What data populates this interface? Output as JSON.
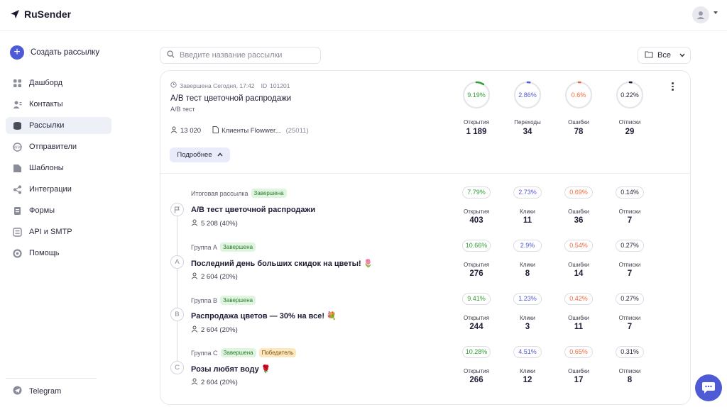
{
  "app": {
    "name": "RuSender"
  },
  "colors": {
    "accent": "#4f5bd5",
    "green": "#2f9e34",
    "blue": "#4f5bd5",
    "orange": "#f0683e",
    "black": "#1d1d35"
  },
  "sidebar": {
    "create_label": "Создать рассылку",
    "items": [
      {
        "label": "Дашборд",
        "icon": "dashboard-icon"
      },
      {
        "label": "Контакты",
        "icon": "contacts-icon"
      },
      {
        "label": "Рассылки",
        "icon": "mailings-icon",
        "active": true
      },
      {
        "label": "Отправители",
        "icon": "senders-icon"
      },
      {
        "label": "Шаблоны",
        "icon": "templates-icon"
      },
      {
        "label": "Интеграции",
        "icon": "integrations-icon"
      },
      {
        "label": "Формы",
        "icon": "forms-icon"
      },
      {
        "label": "API и SMTP",
        "icon": "api-icon"
      },
      {
        "label": "Помощь",
        "icon": "help-icon"
      }
    ],
    "telegram_label": "Telegram"
  },
  "search": {
    "placeholder": "Введите название рассылки"
  },
  "filter": {
    "label": "Все"
  },
  "campaign": {
    "status": "Завершена Сегодня, 17:42",
    "id_label": "ID",
    "id": "101201",
    "title": "А/В тест цветочной распродажи",
    "subtitle": "А/В тест",
    "recipients": "13 020",
    "list_name": "Клиенты Flowwer...",
    "list_count": "(25011)",
    "more_label": "Подробнее",
    "stats": [
      {
        "label": "Открытия",
        "percent": "9.19%",
        "value": "1 189",
        "fraction": 0.0919,
        "color": "#2f9e34"
      },
      {
        "label": "Переходы",
        "percent": "2.86%",
        "value": "34",
        "fraction": 0.0286,
        "color": "#4f5bd5"
      },
      {
        "label": "Ошибки",
        "percent": "0.6%",
        "value": "78",
        "fraction": 0.006,
        "color": "#f0683e"
      },
      {
        "label": "Отписки",
        "percent": "0.22%",
        "value": "29",
        "fraction": 0.0022,
        "color": "#1d1d35"
      }
    ]
  },
  "variants": [
    {
      "marker": "flag",
      "name": "Итоговая рассылка",
      "badges": [
        "Завершена"
      ],
      "title": "А/В тест цветочной распродажи",
      "emoji": "",
      "count": "5 208 (40%)",
      "stats": [
        {
          "label": "Открытия",
          "percent": "7.79%",
          "value": "403"
        },
        {
          "label": "Клики",
          "percent": "2.73%",
          "value": "11"
        },
        {
          "label": "Ошибки",
          "percent": "0.69%",
          "value": "36"
        },
        {
          "label": "Отписки",
          "percent": "0.14%",
          "value": "7"
        }
      ]
    },
    {
      "marker": "A",
      "name": "Группа А",
      "badges": [
        "Завершена"
      ],
      "title": "Последний день больших скидок на цветы!",
      "emoji": "🌷",
      "count": "2 604 (20%)",
      "stats": [
        {
          "label": "Открытия",
          "percent": "10.66%",
          "value": "276"
        },
        {
          "label": "Клики",
          "percent": "2.9%",
          "value": "8"
        },
        {
          "label": "Ошибки",
          "percent": "0.54%",
          "value": "14"
        },
        {
          "label": "Отписки",
          "percent": "0.27%",
          "value": "7"
        }
      ]
    },
    {
      "marker": "B",
      "name": "Группа В",
      "badges": [
        "Завершена"
      ],
      "title": "Распродажа цветов — 30% на все!",
      "emoji": "💐",
      "count": "2 604 (20%)",
      "stats": [
        {
          "label": "Открытия",
          "percent": "9.41%",
          "value": "244"
        },
        {
          "label": "Клики",
          "percent": "1.23%",
          "value": "3"
        },
        {
          "label": "Ошибки",
          "percent": "0.42%",
          "value": "11"
        },
        {
          "label": "Отписки",
          "percent": "0.27%",
          "value": "7"
        }
      ]
    },
    {
      "marker": "C",
      "name": "Группа С",
      "badges": [
        "Завершена",
        "Победитель"
      ],
      "title": "Розы любят воду",
      "emoji": "🌹",
      "count": "2 604 (20%)",
      "stats": [
        {
          "label": "Открытия",
          "percent": "10.28%",
          "value": "266"
        },
        {
          "label": "Клики",
          "percent": "4.51%",
          "value": "12"
        },
        {
          "label": "Ошибки",
          "percent": "0.65%",
          "value": "17"
        },
        {
          "label": "Отписки",
          "percent": "0.31%",
          "value": "8"
        }
      ]
    }
  ]
}
